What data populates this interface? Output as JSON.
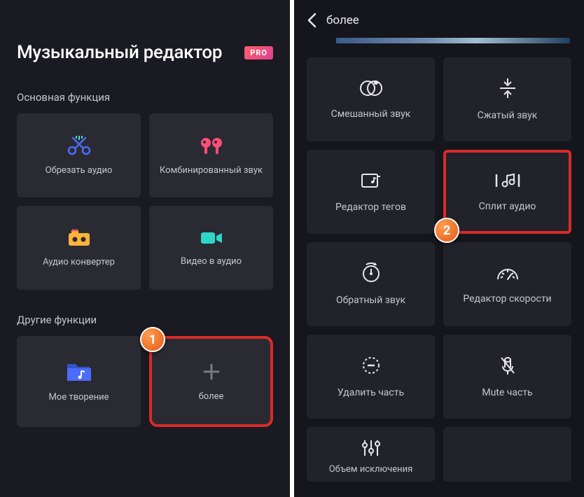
{
  "left": {
    "title": "Музыкальный редактор",
    "pro": "PRO",
    "section_main": "Основная функция",
    "section_other": "Другие функции",
    "tiles": {
      "cut": "Обрезать аудио",
      "combine": "Комбинированный звук",
      "convert": "Аудио конвертер",
      "video": "Видео в аудио",
      "my": "Мое творение",
      "more": "более"
    },
    "badge1": "1"
  },
  "right": {
    "title": "более",
    "tiles": {
      "mix": "Смешанный звук",
      "compress": "Сжатый звук",
      "tags": "Редактор тегов",
      "split": "Сплит аудио",
      "reverse": "Обратный звук",
      "speed": "Редактор скорости",
      "remove": "Удалить часть",
      "mute": "Mute часть",
      "volume": "Объем исключения"
    },
    "badge2": "2"
  }
}
